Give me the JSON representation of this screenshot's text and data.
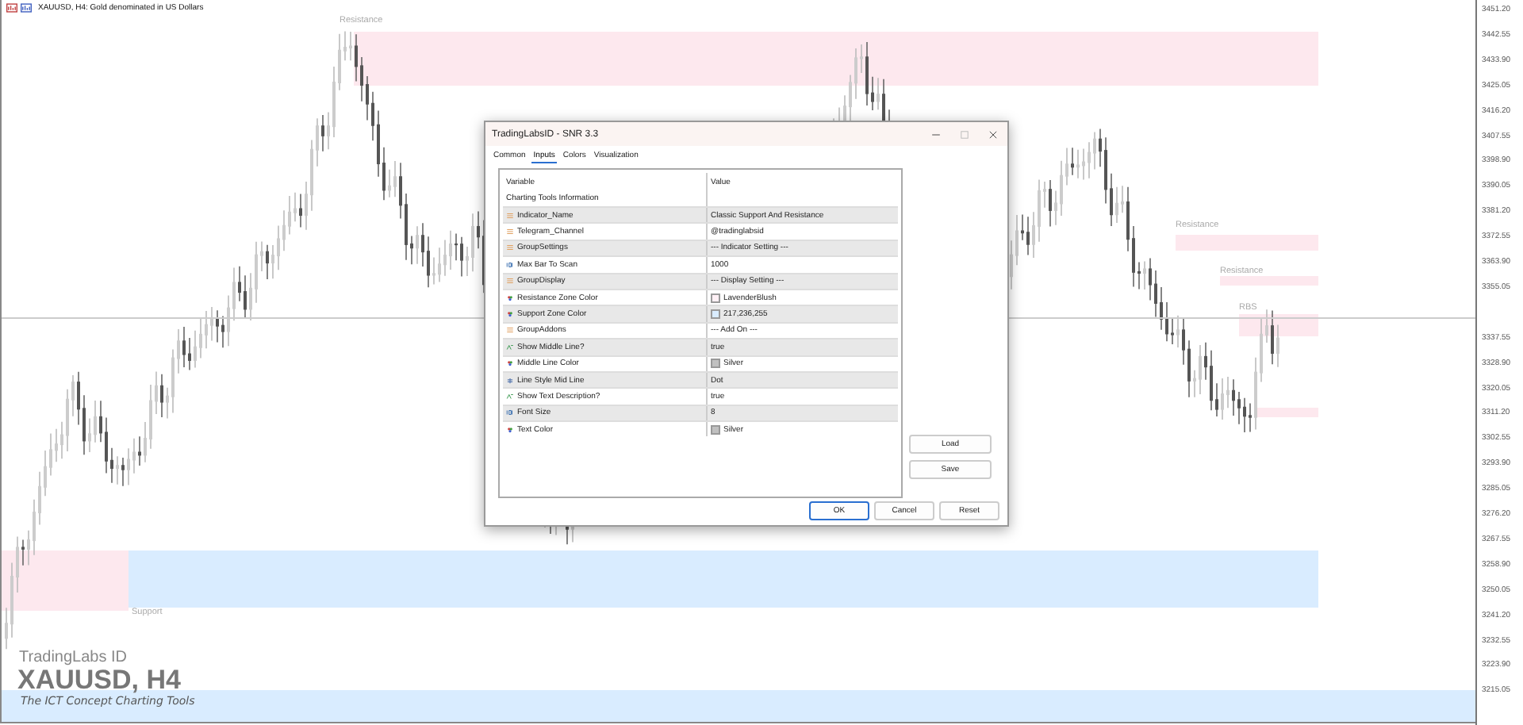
{
  "chart": {
    "title": "XAUUSD, H4: Gold denominated in US Dollars",
    "price_axis": [
      "3451.20",
      "3442.55",
      "3433.90",
      "3425.05",
      "3416.20",
      "3407.55",
      "3398.90",
      "3390.05",
      "3381.20",
      "3372.55",
      "3363.90",
      "3355.05",
      "3337.55",
      "3328.90",
      "3320.05",
      "3311.20",
      "3302.55",
      "3293.90",
      "3285.05",
      "3276.20",
      "3267.55",
      "3258.90",
      "3250.05",
      "3241.20",
      "3232.55",
      "3223.90",
      "3215.05"
    ],
    "zones": [
      {
        "label": "Resistance",
        "kind": "resistance"
      },
      {
        "label": "Resistance",
        "kind": "resistance"
      },
      {
        "label": "Resistance",
        "kind": "resistance"
      },
      {
        "label": "RBS",
        "kind": "resistance"
      },
      {
        "label": "Support",
        "kind": "support"
      }
    ],
    "brand": "TradingLabs ID",
    "symbol": "XAUUSD, H4",
    "tagline": "The ICT Concept Charting Tools"
  },
  "dialog": {
    "title": "TradingLabsID - SNR 3.3",
    "tabs": [
      {
        "label": "Common",
        "selected": false
      },
      {
        "label": "Inputs",
        "selected": true
      },
      {
        "label": "Colors",
        "selected": false
      },
      {
        "label": "Visualization",
        "selected": false
      }
    ],
    "columns": [
      "Variable",
      "Value"
    ],
    "section": "Charting Tools Information",
    "rows": [
      {
        "kind": "string",
        "variable": "Indicator_Name",
        "value": "Classic Support And Resistance"
      },
      {
        "kind": "string",
        "variable": "Telegram_Channel",
        "value": "@tradinglabsid"
      },
      {
        "kind": "string",
        "variable": "GroupSettings",
        "value": "--- Indicator Setting ---"
      },
      {
        "kind": "int",
        "variable": "Max Bar To Scan",
        "value": "1000"
      },
      {
        "kind": "string",
        "variable": "GroupDisplay",
        "value": "--- Display Setting ---"
      },
      {
        "kind": "color",
        "variable": "Resistance Zone Color",
        "value": "LavenderBlush",
        "color": "#fff0f5"
      },
      {
        "kind": "color",
        "variable": "Support Zone Color",
        "value": "217,236,255",
        "color": "#d9ecff"
      },
      {
        "kind": "string",
        "variable": "GroupAddons",
        "value": "--- Add On ---"
      },
      {
        "kind": "bool",
        "variable": "Show Middle Line?",
        "value": "true"
      },
      {
        "kind": "color",
        "variable": "Middle Line Color",
        "value": "Silver",
        "color": "#c0c0c0"
      },
      {
        "kind": "enum",
        "variable": "Line Style Mid Line",
        "value": "Dot"
      },
      {
        "kind": "bool",
        "variable": "Show Text Description?",
        "value": "true"
      },
      {
        "kind": "int",
        "variable": "Font Size",
        "value": "8"
      },
      {
        "kind": "color",
        "variable": "Text Color",
        "value": "Silver",
        "color": "#c0c0c0"
      }
    ],
    "side_buttons": [
      "Load",
      "Save"
    ],
    "buttons": [
      "OK",
      "Cancel",
      "Reset"
    ]
  }
}
